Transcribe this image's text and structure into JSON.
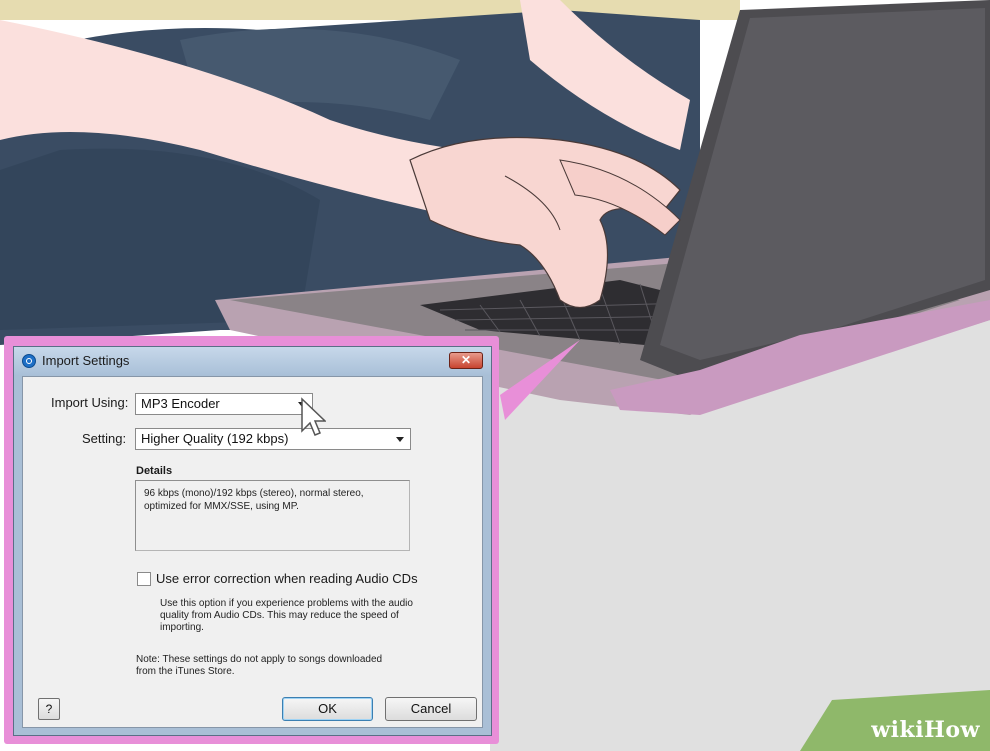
{
  "dialog": {
    "title": "Import Settings",
    "close_label": "✕",
    "import_using_label": "Import Using:",
    "import_using_value": "MP3 Encoder",
    "setting_label": "Setting:",
    "setting_value": "Higher Quality (192 kbps)",
    "details_label": "Details",
    "details_text_line1": "96 kbps (mono)/192 kbps (stereo), normal stereo,",
    "details_text_line2": "optimized for MMX/SSE, using MP.",
    "error_correction_label": "Use error correction when reading Audio CDs",
    "error_correction_checked": false,
    "error_help_line1": "Use this option if you experience problems with the audio",
    "error_help_line2": "quality from Audio CDs.  This may reduce the speed of",
    "error_help_line3": "importing.",
    "note_line1": "Note: These settings do not apply to songs downloaded",
    "note_line2": "from the iTunes Store.",
    "help_label": "?",
    "ok_label": "OK",
    "cancel_label": "Cancel"
  },
  "watermark": {
    "brand_prefix": "wiki",
    "brand_suffix": "How"
  },
  "colors": {
    "callout": "#e88fd8",
    "brand_green": "#8fb86a"
  }
}
